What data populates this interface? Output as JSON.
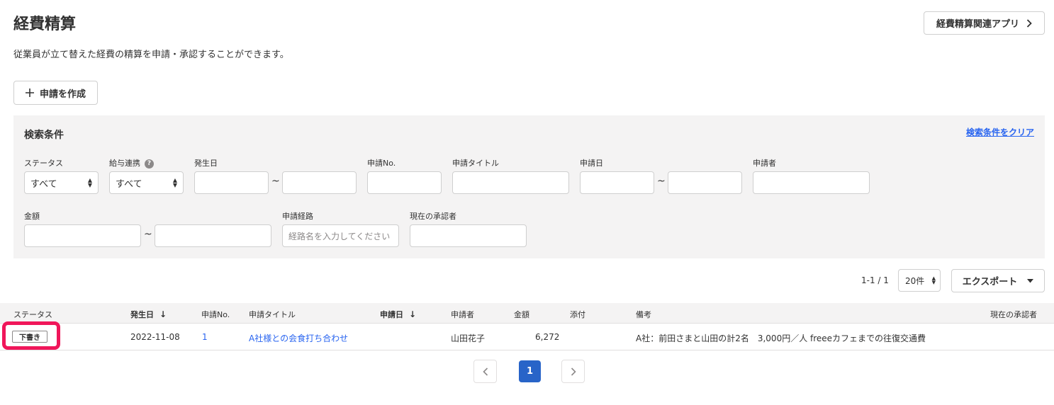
{
  "page": {
    "title": "経費精算",
    "description": "従業員が立て替えた経費の精算を申請・承認することができます。",
    "related_apps_label": "経費精算関連アプリ",
    "related_apps_icon": "chevron-right-icon",
    "create_label": "申請を作成",
    "create_icon": "plus-icon"
  },
  "search": {
    "title": "検索条件",
    "clear_label": "検索条件をクリア",
    "tilde": "~",
    "status": {
      "label": "ステータス",
      "value": "すべて"
    },
    "payroll": {
      "label": "給与連携",
      "value": "すべて",
      "help": "?"
    },
    "occurrence_date": {
      "label": "発生日"
    },
    "application_no": {
      "label": "申請No."
    },
    "application_title": {
      "label": "申請タイトル"
    },
    "application_date": {
      "label": "申請日"
    },
    "applicant": {
      "label": "申請者"
    },
    "amount": {
      "label": "金額"
    },
    "route": {
      "label": "申請経路",
      "placeholder": "経路名を入力してください"
    },
    "current_approver": {
      "label": "現在の承認者"
    }
  },
  "toolbar": {
    "count": "1-1 / 1",
    "per_page": "20件",
    "export_label": "エクスポート",
    "export_icon": "caret-down-icon"
  },
  "table": {
    "headers": {
      "status": "ステータス",
      "occurrence_date": "発生日",
      "application_no": "申請No.",
      "title": "申請タイトル",
      "application_date": "申請日",
      "applicant": "申請者",
      "amount": "金額",
      "attachment": "添付",
      "remarks": "備考",
      "current_approver": "現在の承認者"
    },
    "sort_icon": "↓",
    "rows": [
      {
        "status": "下書き",
        "occurrence_date": "2022-11-08",
        "application_no": "1",
        "title": "A社様との会食打ち合わせ",
        "application_date": "",
        "applicant": "山田花子",
        "amount": "6,272",
        "attachment": "",
        "remarks": "A社：前田さまと山田の計2名　3,000円／人 freeeカフェまでの往復交通費",
        "current_approver": ""
      }
    ]
  },
  "pagination": {
    "prev_icon": "chevron-left-icon",
    "current": "1",
    "next_icon": "chevron-right-icon"
  },
  "colors": {
    "accent": "#2864c8",
    "link": "#2864f0",
    "highlight": "#f0165a",
    "panel_bg": "#f4f3f3"
  }
}
